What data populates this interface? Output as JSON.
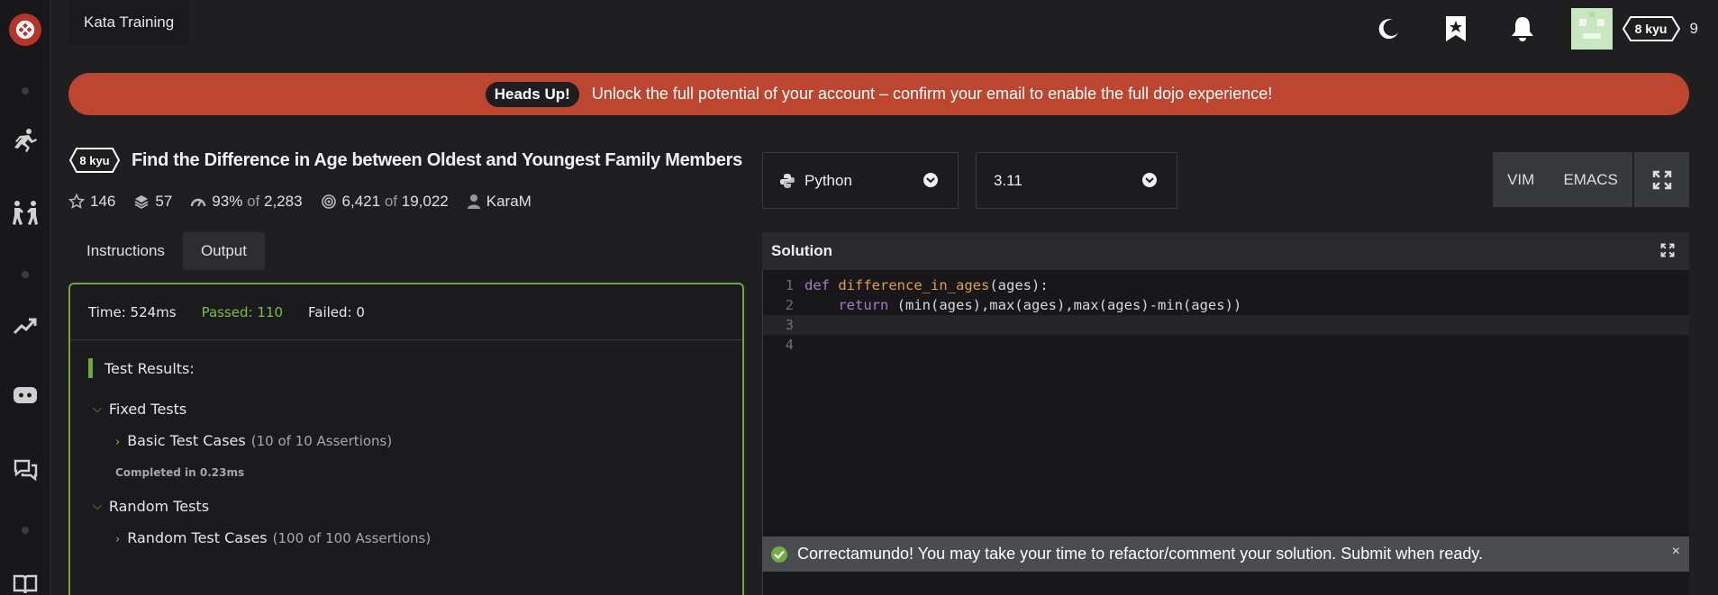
{
  "topbar": {
    "breadcrumb": "Kata Training",
    "rank": "8 kyu",
    "honor": "9"
  },
  "banner": {
    "tag": "Heads Up!",
    "message": "Unlock the full potential of your account – confirm your email to enable the full dojo experience!"
  },
  "kata": {
    "rank": "8 kyu",
    "title": "Find the Difference in Age between Oldest and Youngest Family Members",
    "stars": "146",
    "collections": "57",
    "satisfaction": "93%",
    "satisfaction_of": "of",
    "votes": "2,283",
    "completed": "6,421",
    "completed_of": "of",
    "attempts": "19,022",
    "author": "KaraM"
  },
  "tabs": {
    "instructions": "Instructions",
    "output": "Output"
  },
  "output": {
    "time": "Time: 524ms",
    "passed": "Passed: 110",
    "failed": "Failed: 0",
    "results_title": "Test Results:",
    "groups": [
      {
        "name": "Fixed Tests",
        "case": "Basic Test Cases",
        "count": "(10 of 10 Assertions)",
        "completed": "Completed in 0.23ms"
      },
      {
        "name": "Random Tests",
        "case": "Random Test Cases",
        "count": "(100 of 100 Assertions)"
      }
    ]
  },
  "editor": {
    "language": "Python",
    "version": "3.11",
    "mode_vim": "VIM",
    "mode_emacs": "EMACS",
    "header": "Solution",
    "line_numbers": [
      "1",
      "2",
      "3",
      "4"
    ],
    "def_kw": "def",
    "fn_name": "difference_in_ages",
    "params": "(ages):",
    "return_kw": "return",
    "return_expr": " (min(ages),max(ages),max(ages)-min(ages))"
  },
  "toast": {
    "message": "Correctamundo! You may take your time to refactor/comment your solution. Submit when ready.",
    "close": "×"
  },
  "colors": {
    "accent_green": "#6da73d",
    "banner_red": "#bd4630",
    "logo_red": "#b5342c"
  }
}
